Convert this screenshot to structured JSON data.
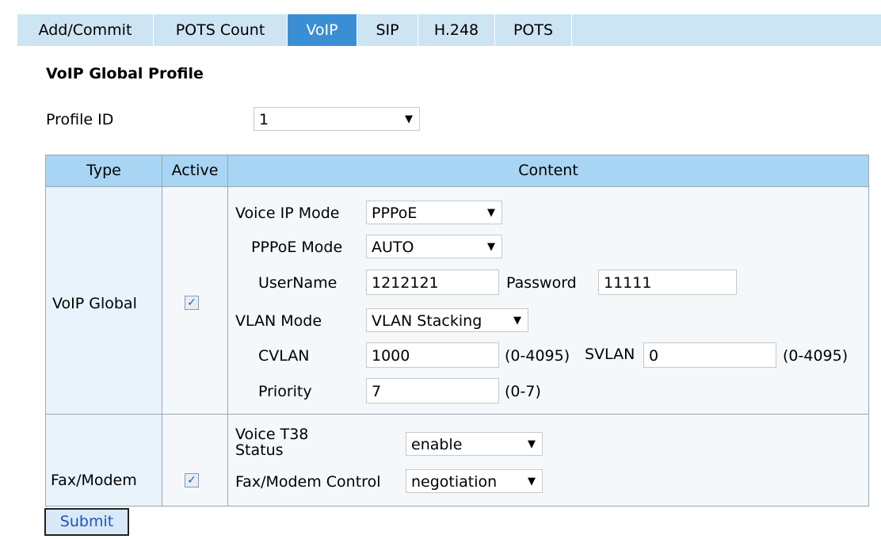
{
  "tabs": [
    {
      "label": "Add/Commit",
      "active": false
    },
    {
      "label": "POTS Count",
      "active": false
    },
    {
      "label": "VoIP",
      "active": true
    },
    {
      "label": "SIP",
      "active": false
    },
    {
      "label": "H.248",
      "active": false
    },
    {
      "label": "POTS",
      "active": false
    }
  ],
  "heading": "VoIP Global Profile",
  "profile": {
    "label": "Profile ID",
    "value": "1"
  },
  "table": {
    "headers": {
      "type": "Type",
      "active": "Active",
      "content": "Content"
    },
    "rows": [
      {
        "type": "VoIP Global",
        "active": true,
        "voice_ip_mode": {
          "label": "Voice IP Mode",
          "value": "PPPoE"
        },
        "pppoe_mode": {
          "label": "PPPoE Mode",
          "value": "AUTO"
        },
        "username": {
          "label": "UserName",
          "value": "1212121"
        },
        "password": {
          "label": "Password",
          "value": "11111"
        },
        "vlan_mode": {
          "label": "VLAN Mode",
          "value": "VLAN Stacking"
        },
        "cvlan": {
          "label": "CVLAN",
          "value": "1000",
          "range": "(0-4095)"
        },
        "svlan": {
          "label": "SVLAN",
          "value": "0",
          "range": "(0-4095)"
        },
        "priority": {
          "label": "Priority",
          "value": "7",
          "range": "(0-7)"
        }
      },
      {
        "type": "Fax/Modem",
        "active": true,
        "t38": {
          "label_line1": "Voice T38",
          "label_line2": "Status",
          "value": "enable"
        },
        "fax_control": {
          "label": "Fax/Modem Control",
          "value": "negotiation"
        }
      }
    ]
  },
  "submit_label": "Submit",
  "colors": {
    "tab_bar": "#cde4f3",
    "tab_active": "#3a8fd4",
    "table_header": "#a8d5f3",
    "cell_bg": "#f4f8fb"
  }
}
